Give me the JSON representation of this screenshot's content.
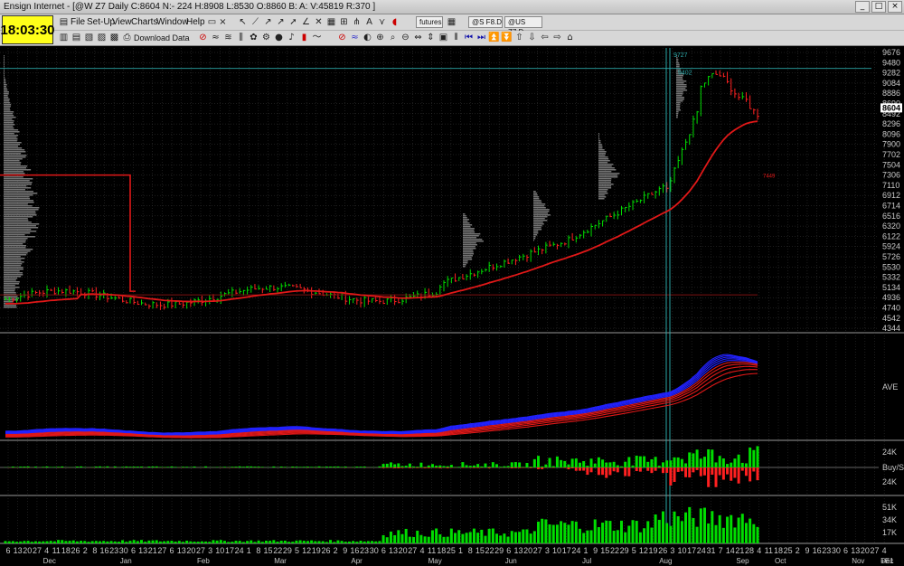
{
  "window": {
    "title": "Ensign Internet - [@W Z7 Daily C:8604 N:- 224 H:8908 L:8530 O:8860 B: A: V:45819 R:370 ]"
  },
  "clock": "18:03:30",
  "menu": [
    "File",
    "Set-Up",
    "View",
    "Charts",
    "Window",
    "Help"
  ],
  "toolbar2": {
    "download_label": "Download Data"
  },
  "symbols": {
    "combo": "futures",
    "tab1": "@S F8.D",
    "tab2": "@US Z7.D"
  },
  "colors": {
    "up": "#00dd00",
    "down": "#ff2020",
    "ma": "#e01818",
    "ribbon_blue": "#2222ff",
    "grid": "#3a3a3a",
    "label": "#c8c8c8"
  },
  "price_axis": {
    "labels": [
      "9676",
      "9480",
      "9282",
      "9084",
      "8886",
      "8690",
      "8492",
      "8296",
      "8096",
      "7900",
      "7702",
      "7504",
      "7306",
      "7110",
      "6912",
      "6714",
      "6516",
      "6320",
      "6122",
      "5924",
      "5726",
      "5530",
      "5332",
      "5134",
      "4936",
      "4740",
      "4542",
      "4344"
    ],
    "current": "8604",
    "annotations": [
      "9727",
      "9402",
      "7449"
    ]
  },
  "lower_panels": {
    "ribbon_label": "AVE",
    "buysell_labels": [
      "24K",
      "Buy/S",
      "24K"
    ],
    "volume_labels": [
      "51K",
      "34K",
      "17K"
    ]
  },
  "date_axis": {
    "days": [
      "6",
      "13",
      "20",
      "27",
      "4",
      "11",
      "18",
      "26",
      "2",
      "8",
      "16",
      "23",
      "30",
      "6",
      "13",
      "21",
      "27",
      "6",
      "13",
      "20",
      "27",
      "3",
      "10",
      "17",
      "24",
      "1",
      "8",
      "15",
      "22",
      "29",
      "5",
      "12",
      "19",
      "26",
      "2",
      "9",
      "16",
      "23",
      "30",
      "6",
      "13",
      "20",
      "27",
      "4",
      "11",
      "18",
      "25",
      "1",
      "8",
      "15",
      "22",
      "29",
      "6",
      "13",
      "20",
      "27",
      "3",
      "10",
      "17",
      "24",
      "1",
      "9",
      "15",
      "22",
      "29",
      "5",
      "12",
      "19",
      "26",
      "3",
      "10",
      "17",
      "24",
      "31",
      "7",
      "14",
      "21",
      "28",
      "4",
      "11",
      "18",
      "25",
      "2",
      "9",
      "16",
      "23",
      "30",
      "6",
      "13",
      "20",
      "27",
      "4"
    ],
    "months": [
      "Dec",
      "Jan",
      "Feb",
      "Mar",
      "Apr",
      "May",
      "Jun",
      "Jul",
      "Aug",
      "Sep",
      "Oct",
      "Nov",
      "Dec",
      "+E1"
    ]
  }
}
